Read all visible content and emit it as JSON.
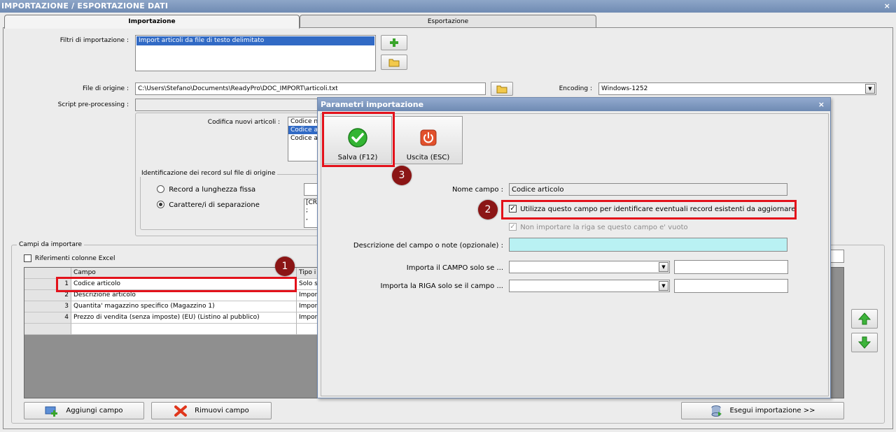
{
  "window": {
    "title": "IMPORTAZIONE / ESPORTAZIONE DATI",
    "close": "×"
  },
  "tabs": [
    {
      "label": "Importazione",
      "active": true
    },
    {
      "label": "Esportazione",
      "active": false
    }
  ],
  "import": {
    "filters_label": "Filtri di importazione :",
    "filters_items": [
      "Import articoli da file di testo delimitato"
    ],
    "file_label": "File di origine :",
    "file_value": "C:\\Users\\Stefano\\Documents\\ReadyPro\\DOC_IMPORT\\articoli.txt",
    "encoding_label": "Encoding :",
    "encoding_value": "Windows-1252",
    "script_label": "Script pre-processing :",
    "script_value": "",
    "codifica_label": "Codifica nuovi articoli :",
    "codifica_items": [
      "Codice n",
      "Codice a",
      "Codice a"
    ],
    "ident_legend": "Identificazione dei record sul file di origine",
    "radio_fixed": "Record a lunghezza fissa",
    "radio_sep": "Carattere/i di separazione",
    "sep_items": [
      "[CR",
      ";",
      ","
    ]
  },
  "fields_section": {
    "legend": "Campi da importare",
    "excel_label": "Riferimenti colonne Excel",
    "columns": [
      "Campo",
      "Tipo i"
    ],
    "rows": [
      {
        "n": "1",
        "campo": "Codice articolo",
        "tipo": "Solo s"
      },
      {
        "n": "2",
        "campo": "Descrizione articolo",
        "tipo": "Impor"
      },
      {
        "n": "3",
        "campo": "Quantita' magazzino specifico (Magazzino 1)",
        "tipo": "Impor"
      },
      {
        "n": "4",
        "campo": "Prezzo di vendita (senza imposte) (EU) (Listino al pubblico)",
        "tipo": "Impor"
      }
    ],
    "add_button": "Aggiungi campo",
    "remove_button": "Rimuovi campo",
    "run_button": "Esegui importazione >>"
  },
  "dialog": {
    "title": "Parametri importazione",
    "close": "×",
    "save_button": "Salva (F12)",
    "exit_button": "Uscita (ESC)",
    "nome_label": "Nome campo :",
    "nome_value": "Codice articolo",
    "check_identify": "Utilizza questo campo per identificare eventuali record esistenti da aggiornare",
    "check_empty": "Non importare la riga se questo campo e' vuoto",
    "desc_label": "Descrizione del campo o note (opzionale) :",
    "desc_value": "",
    "cond_campo_label": "Importa il CAMPO solo se ...",
    "cond_riga_label": "Importa la RIGA solo se il campo ..."
  },
  "annotations": [
    "1",
    "2",
    "3"
  ],
  "colors": {
    "title_bar": "#7a94bb",
    "highlight_box": "#e3121b",
    "badge": "#8b1515",
    "selection": "#316ac5",
    "desc_field": "#b9f1f3"
  }
}
